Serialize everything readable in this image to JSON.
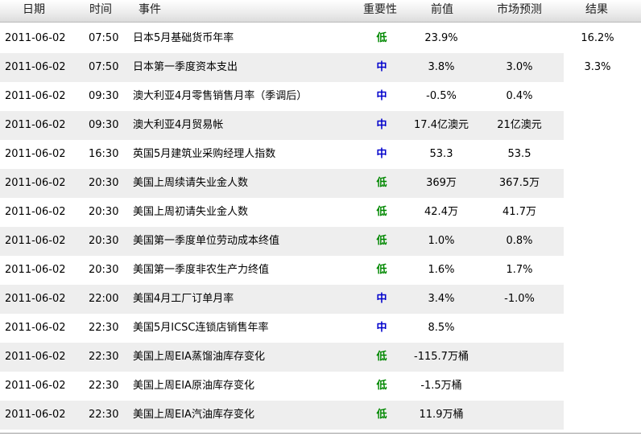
{
  "headers": {
    "date": "日期",
    "time": "时间",
    "event": "事件",
    "importance": "重要性",
    "previous": "前值",
    "forecast": "市场预测",
    "result": "结果"
  },
  "colors": {
    "low": "#008800",
    "medium": "#0000cc",
    "stripe": "#eeeeee"
  },
  "rows": [
    {
      "date": "2011-06-02",
      "time": "07:50",
      "event": "日本5月基础货币年率",
      "importance": "低",
      "level": "low",
      "previous": "23.9%",
      "forecast": "",
      "result": "16.2%"
    },
    {
      "date": "2011-06-02",
      "time": "07:50",
      "event": "日本第一季度资本支出",
      "importance": "中",
      "level": "mid",
      "previous": "3.8%",
      "forecast": "3.0%",
      "result": "3.3%"
    },
    {
      "date": "2011-06-02",
      "time": "09:30",
      "event": "澳大利亚4月零售销售月率（季调后）",
      "importance": "中",
      "level": "mid",
      "previous": "-0.5%",
      "forecast": "0.4%",
      "result": ""
    },
    {
      "date": "2011-06-02",
      "time": "09:30",
      "event": "澳大利亚4月贸易帐",
      "importance": "中",
      "level": "mid",
      "previous": "17.4亿澳元",
      "forecast": "21亿澳元",
      "result": ""
    },
    {
      "date": "2011-06-02",
      "time": "16:30",
      "event": "英国5月建筑业采购经理人指数",
      "importance": "中",
      "level": "mid",
      "previous": "53.3",
      "forecast": "53.5",
      "result": ""
    },
    {
      "date": "2011-06-02",
      "time": "20:30",
      "event": "美国上周续请失业金人数",
      "importance": "低",
      "level": "low",
      "previous": "369万",
      "forecast": "367.5万",
      "result": ""
    },
    {
      "date": "2011-06-02",
      "time": "20:30",
      "event": "美国上周初请失业金人数",
      "importance": "低",
      "level": "low",
      "previous": "42.4万",
      "forecast": "41.7万",
      "result": ""
    },
    {
      "date": "2011-06-02",
      "time": "20:30",
      "event": "美国第一季度单位劳动成本终值",
      "importance": "低",
      "level": "low",
      "previous": "1.0%",
      "forecast": "0.8%",
      "result": ""
    },
    {
      "date": "2011-06-02",
      "time": "20:30",
      "event": "美国第一季度非农生产力终值",
      "importance": "低",
      "level": "low",
      "previous": "1.6%",
      "forecast": "1.7%",
      "result": ""
    },
    {
      "date": "2011-06-02",
      "time": "22:00",
      "event": "美国4月工厂订单月率",
      "importance": "中",
      "level": "mid",
      "previous": "3.4%",
      "forecast": "-1.0%",
      "result": ""
    },
    {
      "date": "2011-06-02",
      "time": "22:30",
      "event": "美国5月ICSC连锁店销售年率",
      "importance": "中",
      "level": "mid",
      "previous": "8.5%",
      "forecast": "",
      "result": ""
    },
    {
      "date": "2011-06-02",
      "time": "22:30",
      "event": "美国上周EIA蒸馏油库存变化",
      "importance": "低",
      "level": "low",
      "previous": "-115.7万桶",
      "forecast": "",
      "result": ""
    },
    {
      "date": "2011-06-02",
      "time": "22:30",
      "event": "美国上周EIA原油库存变化",
      "importance": "低",
      "level": "low",
      "previous": "-1.5万桶",
      "forecast": "",
      "result": ""
    },
    {
      "date": "2011-06-02",
      "time": "22:30",
      "event": "美国上周EIA汽油库存变化",
      "importance": "低",
      "level": "low",
      "previous": "11.9万桶",
      "forecast": "",
      "result": ""
    }
  ]
}
